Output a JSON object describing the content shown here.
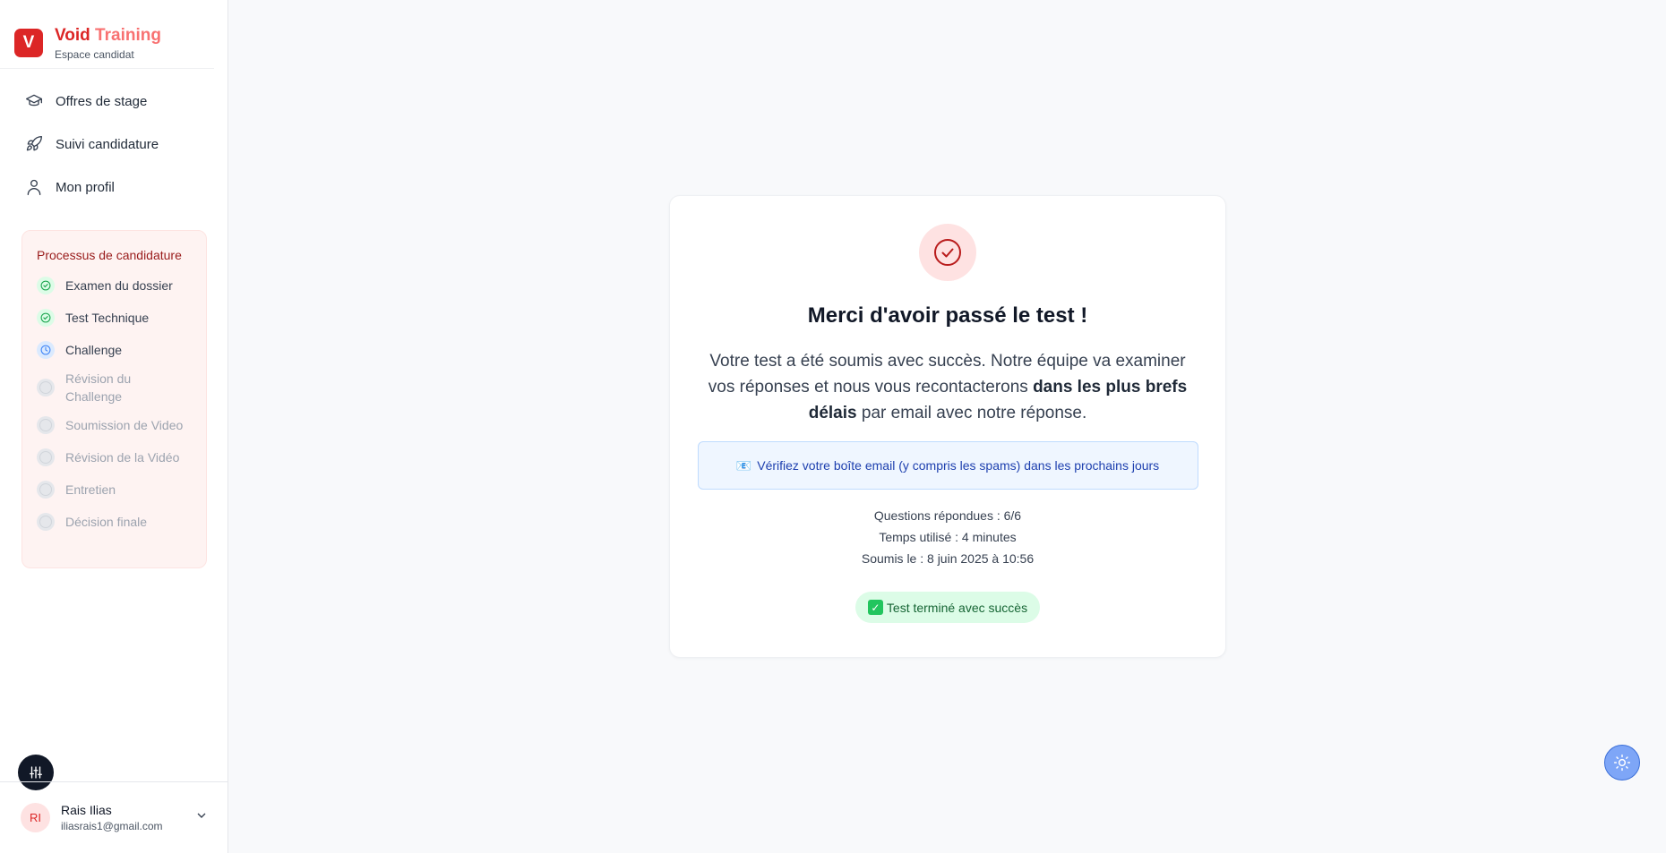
{
  "brand": {
    "logo_letter": "V",
    "name_part1": "Void",
    "name_part2": " Training",
    "subtitle": "Espace candidat"
  },
  "nav": {
    "items": [
      {
        "label": "Offres de stage",
        "icon": "graduation-cap-icon"
      },
      {
        "label": "Suivi candidature",
        "icon": "rocket-icon"
      },
      {
        "label": "Mon profil",
        "icon": "user-icon"
      }
    ]
  },
  "process": {
    "title": "Processus de candidature",
    "steps": [
      {
        "label": "Examen du dossier",
        "status": "done"
      },
      {
        "label": "Test Technique",
        "status": "done"
      },
      {
        "label": "Challenge",
        "status": "current"
      },
      {
        "label": "Révision du Challenge",
        "status": "pending"
      },
      {
        "label": "Soumission de Video",
        "status": "pending"
      },
      {
        "label": "Révision de la Vidéo",
        "status": "pending"
      },
      {
        "label": "Entretien",
        "status": "pending"
      },
      {
        "label": "Décision finale",
        "status": "pending"
      }
    ]
  },
  "user": {
    "initials": "RI",
    "name": "Rais Ilias",
    "email": "iliasrais1@gmail.com"
  },
  "card": {
    "title": "Merci d'avoir passé le test !",
    "message_part1": "Votre test a été soumis avec succès. Notre équipe va examiner vos réponses et nous vous recontacterons ",
    "message_bold": "dans les plus brefs délais",
    "message_part2": " par email avec notre réponse.",
    "info_icon": "📧",
    "info_text": "Vérifiez votre boîte email (y compris les spams) dans les prochains jours",
    "stats": {
      "questions": "Questions répondues : 6/6",
      "time": "Temps utilisé : 4 minutes",
      "submitted": "Soumis le : 8 juin 2025 à 10:56"
    },
    "badge_tick": "✓",
    "badge_text": "Test terminé avec succès"
  },
  "colors": {
    "brand": "#dc2626",
    "success": "#22c55e",
    "info": "#1e40af",
    "current_step": "#3b82f6"
  }
}
